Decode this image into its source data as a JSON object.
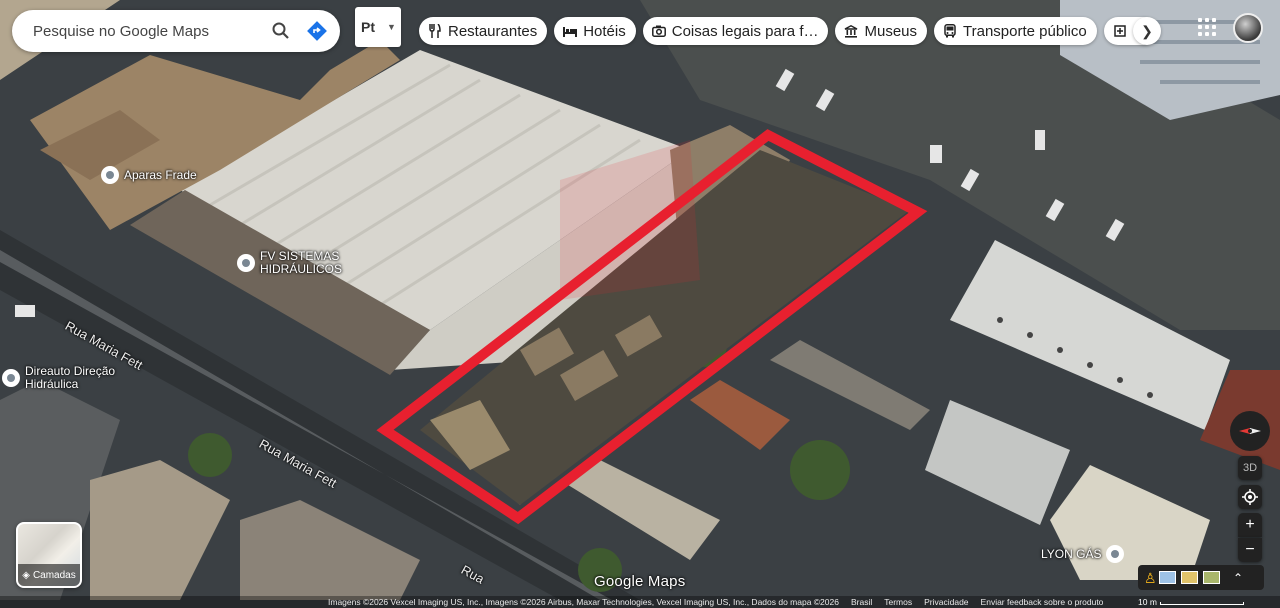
{
  "search": {
    "placeholder": "Pesquise no Google Maps"
  },
  "language": {
    "code": "Pt"
  },
  "chips": {
    "restaurants": "Restaurantes",
    "hotels": "Hotéis",
    "things_to_do": "Coisas legais para f…",
    "museums": "Museus",
    "transit": "Transporte público"
  },
  "pois": {
    "aparas": "Aparas Frade",
    "fv_line1": "FV SISTEMAS",
    "fv_line2": "HIDRÁULICOS",
    "direauto_line1": "Direauto Direção",
    "direauto_line2": "Hidráulica",
    "lyon": "LYON GÁS"
  },
  "streets": {
    "s1": "Rua Maria Fett",
    "s2": "Rua Maria Fett",
    "s3": "Rua"
  },
  "layers_label": "Camadas",
  "controls": {
    "mode_3d": "3D",
    "zoom_in": "+",
    "zoom_out": "−"
  },
  "watermark": "Google Maps",
  "footer": {
    "imagery": "Imagens ©2026 Vexcel Imaging US, Inc., Imagens ©2026 Airbus, Maxar Technologies, Vexcel Imaging US, Inc., Dados do mapa ©2026",
    "country": "Brasil",
    "terms": "Termos",
    "privacy": "Privacidade",
    "feedback": "Enviar feedback sobre o produto",
    "scale": "10 m"
  },
  "colors": {
    "highlight": "#e8202f",
    "poi_pin": "#7a8793"
  },
  "icons": {
    "search": "search-icon",
    "directions": "directions-icon",
    "layers": "layers-icon"
  }
}
